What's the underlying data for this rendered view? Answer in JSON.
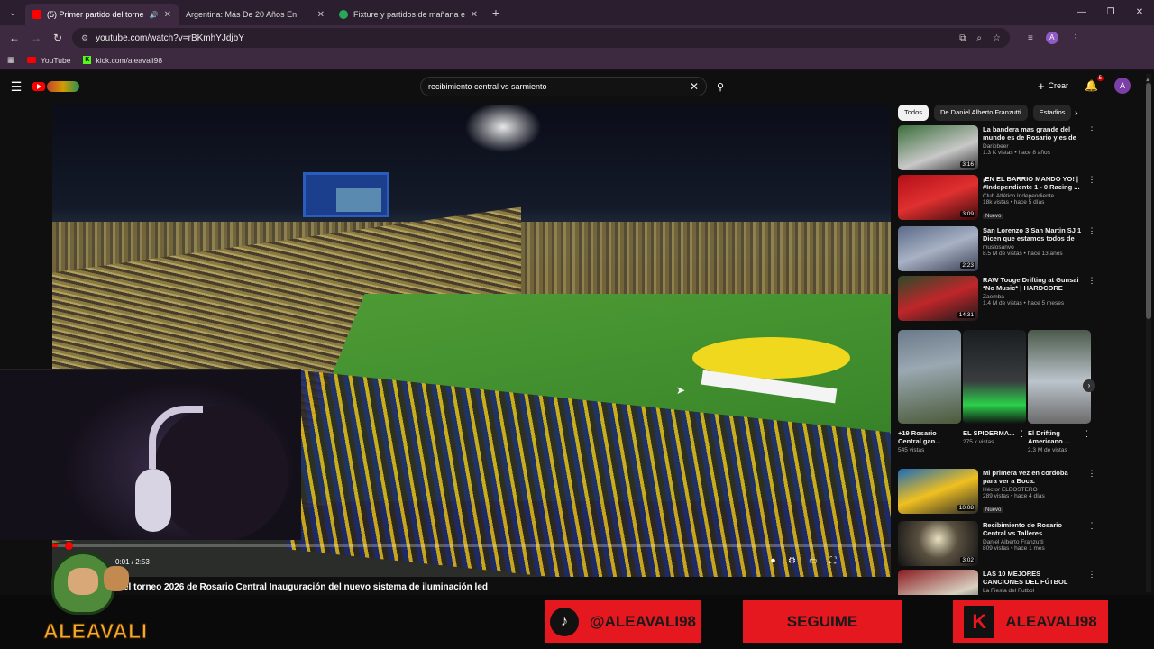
{
  "browser": {
    "tabs": [
      {
        "title": "(5) Primer partido del torne",
        "active": true
      },
      {
        "title": "Argentina: Más De 20 Años En",
        "active": false
      },
      {
        "title": "Fixture y partidos de mañana e",
        "active": false
      }
    ],
    "url": "youtube.com/watch?v=rBKmhYJdjbY",
    "bookmarks": [
      "YouTube",
      "kick.com/aleavali98"
    ]
  },
  "youtube": {
    "search_query": "recibimiento central vs sarmiento",
    "create_label": "Crear",
    "notification_count": "5",
    "avatar_letter": "A",
    "video": {
      "time": "0:01 / 2:53",
      "progress_fraction": 0.006,
      "title": "el torneo 2026 de Rosario Central Inauguración del nuevo sistema de iluminación led"
    },
    "chips": [
      "Todos",
      "De Daniel Alberto Franzutti",
      "Estadios"
    ],
    "recommendations": [
      {
        "title": "La bandera mas grande del mundo es de Rosario y es de ...",
        "channel": "Dariobeer",
        "meta": "1.3 K vistas • hace 8 años",
        "duration": "3:16",
        "badge": ""
      },
      {
        "title": "¡EN EL BARRIO MANDO YO! | #Independiente 1 - 0 Racing ...",
        "channel": "Club Atlético Independiente",
        "meta": "18k vistas • hace 5 días",
        "duration": "3:09",
        "badge": "Nuevo"
      },
      {
        "title": "San Lorenzo 3 San Martin SJ 1 Dicen que estamos todos de l...",
        "channel": "muslosanvo",
        "meta": "8.5 M de vistas • hace 13 años",
        "duration": "2:23",
        "badge": ""
      },
      {
        "title": "RAW Touge Drifting at Gunsai *No Music* | HARDCORE Toky...",
        "channel": "Zaemba",
        "meta": "1.4 M de vistas • hace 5 meses",
        "duration": "14:31",
        "badge": ""
      }
    ],
    "shorts": [
      {
        "title": "+19 Rosario Central gan...",
        "views": "545 vistas"
      },
      {
        "title": "EL SPIDERMA...",
        "views": "275 k vistas"
      },
      {
        "title": "El Drifting Americano ...",
        "views": "2.3 M de vistas"
      }
    ],
    "recommendations_more": [
      {
        "title": "Mi primera vez en cordoba para ver a Boca.",
        "channel": "Héctor ELBOSTERO",
        "meta": "289 vistas • hace 4 días",
        "duration": "10:08",
        "badge": "Nuevo"
      },
      {
        "title": "Recibimiento de Rosario Central vs Talleres",
        "channel": "Daniel Alberto Franzutti",
        "meta": "809 vistas • hace 1 mes",
        "duration": "3:02",
        "badge": ""
      },
      {
        "title": "LAS 10 MEJORES CANCIONES DEL FÚTBOL ARGENTINO // ...",
        "channel": "La Fiesta del Futbol",
        "meta": "",
        "duration": "",
        "badge": ""
      }
    ]
  },
  "overlay": {
    "brand": "ALEAVALI",
    "tiktok": "@ALEAVALI98",
    "follow": "SEGUIME",
    "kick": "ALEAVALI98"
  },
  "colors": {
    "accent": "#ff0000",
    "overlay_red": "#e5171f",
    "brand_orange": "#f2aa2a"
  }
}
